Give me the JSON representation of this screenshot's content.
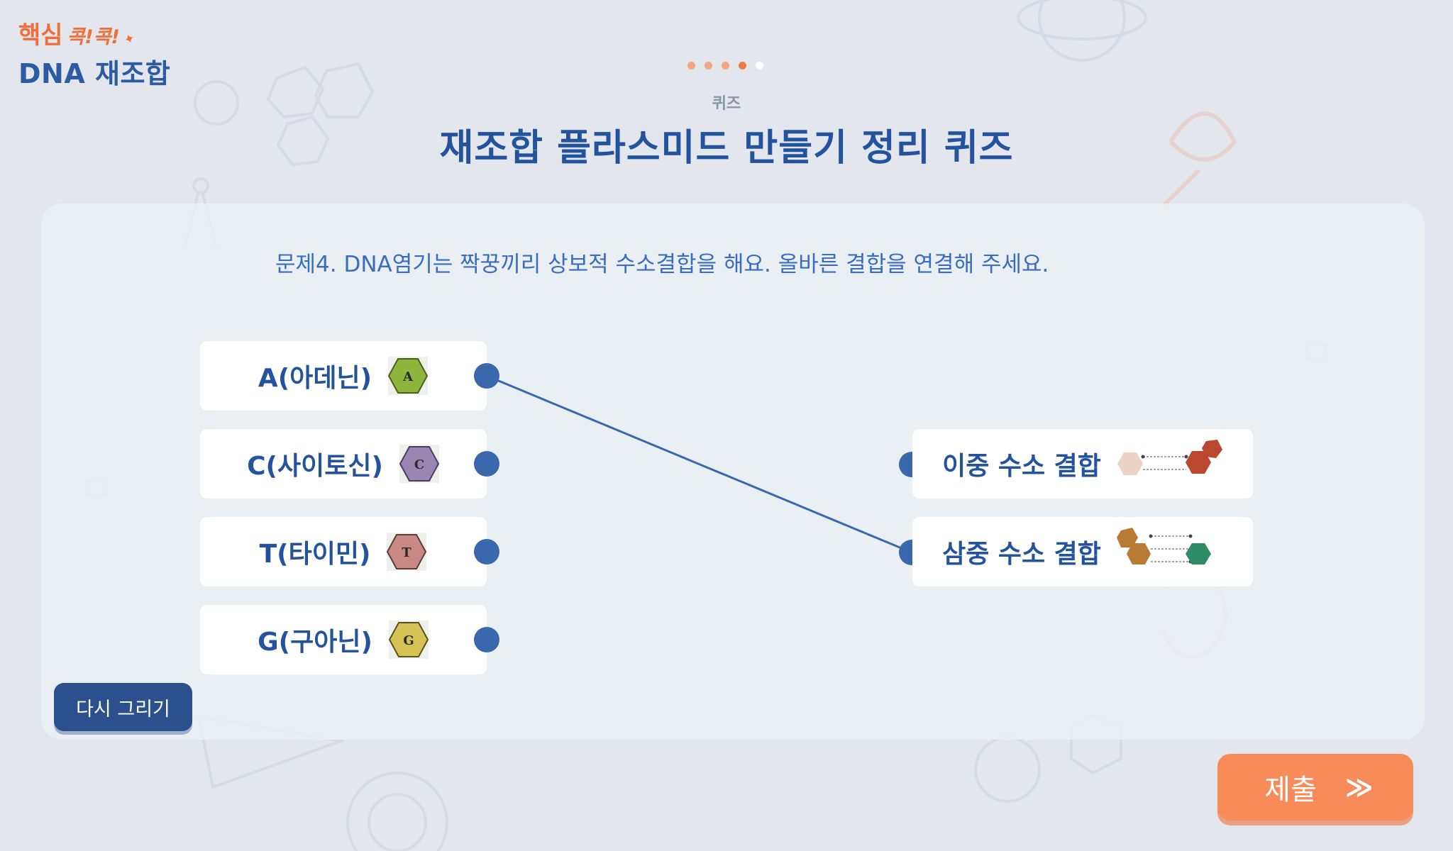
{
  "brand": {
    "main": "핵심",
    "sub": "콕!콕!",
    "title": "DNA 재조합"
  },
  "progress": {
    "total": 5,
    "current": 4
  },
  "header": {
    "section_label": "퀴즈",
    "title": "재조합 플라스미드 만들기 정리 퀴즈"
  },
  "quiz": {
    "question": "문제4.  DNA염기는 짝꿍끼리 상보적 수소결합을 해요. 올바른 결합을 연결해 주세요.",
    "left_items": [
      {
        "label": "A(아데닌)",
        "base": "A",
        "color": "#8fb43c"
      },
      {
        "label": "C(사이토신)",
        "base": "C",
        "color": "#9b86b3"
      },
      {
        "label": "T(타이민)",
        "base": "T",
        "color": "#c98a83"
      },
      {
        "label": "G(구아닌)",
        "base": "G",
        "color": "#d7c255"
      }
    ],
    "right_items": [
      {
        "label": "이중 수소 결합",
        "icon": "double-hydrogen-bond-icon"
      },
      {
        "label": "삼중 수소 결합",
        "icon": "triple-hydrogen-bond-icon"
      }
    ],
    "connections": [
      {
        "left": 0,
        "right": 1
      }
    ]
  },
  "buttons": {
    "redraw": "다시 그리기",
    "submit": "제출"
  },
  "colors": {
    "accent": "#ee7a45",
    "primary": "#24539e",
    "handle": "#3a68ad",
    "line": "#3a68ad"
  }
}
